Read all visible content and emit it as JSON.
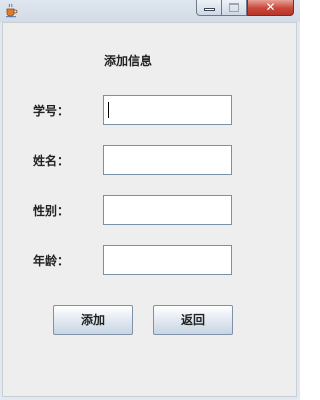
{
  "window": {
    "controls": {
      "minimize_icon": "minimize-icon",
      "maximize_icon": "maximize-icon",
      "close_label": "✕"
    },
    "app_icon": "java-cup-icon"
  },
  "form": {
    "title": "添加信息",
    "fields": [
      {
        "label": "学号：",
        "value": ""
      },
      {
        "label": "姓名：",
        "value": ""
      },
      {
        "label": "性别：",
        "value": ""
      },
      {
        "label": "年龄：",
        "value": ""
      }
    ],
    "add_button": "添加",
    "back_button": "返回"
  }
}
